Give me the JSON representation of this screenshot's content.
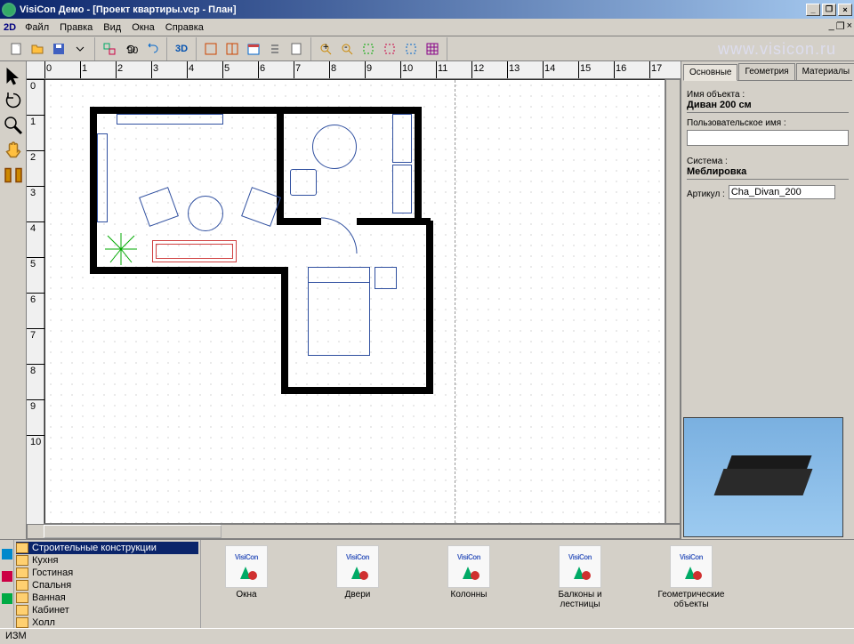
{
  "titlebar": {
    "app_title": "VisiCon Демо - [Проект квартиры.vcp - План]"
  },
  "menubar": {
    "mode": "2D",
    "items": [
      "Файл",
      "Правка",
      "Вид",
      "Окна",
      "Справка"
    ]
  },
  "toolbar": {
    "mode3d_label": "3D",
    "rot_label": "90",
    "watermark": "www.visicon.ru"
  },
  "ruler_h": [
    "0",
    "1",
    "2",
    "3",
    "4",
    "5",
    "6",
    "7",
    "8",
    "9",
    "10",
    "11",
    "12",
    "13",
    "14",
    "15",
    "16",
    "17"
  ],
  "ruler_v": [
    "0",
    "1",
    "2",
    "3",
    "4",
    "5",
    "6",
    "7",
    "8",
    "9",
    "10"
  ],
  "right_panel": {
    "tabs": [
      "Основные",
      "Геометрия",
      "Материалы"
    ],
    "obj_name_label": "Имя объекта :",
    "obj_name": "Диван 200 см",
    "user_name_label": "Пользовательское имя :",
    "user_name": "",
    "system_label": "Система :",
    "system": "Меблировка",
    "article_label": "Артикул :",
    "article": "Cha_Divan_200"
  },
  "bottom": {
    "folders": [
      "Строительные конструкции",
      "Кухня",
      "Гостиная",
      "Спальня",
      "Ванная",
      "Кабинет",
      "Холл"
    ],
    "gallery_brand": "VisiCon",
    "gallery": [
      "Окна",
      "Двери",
      "Колонны",
      "Балконы и лестницы",
      "Геометрические объекты"
    ]
  },
  "statusbar": {
    "left": "ИЗМ"
  }
}
